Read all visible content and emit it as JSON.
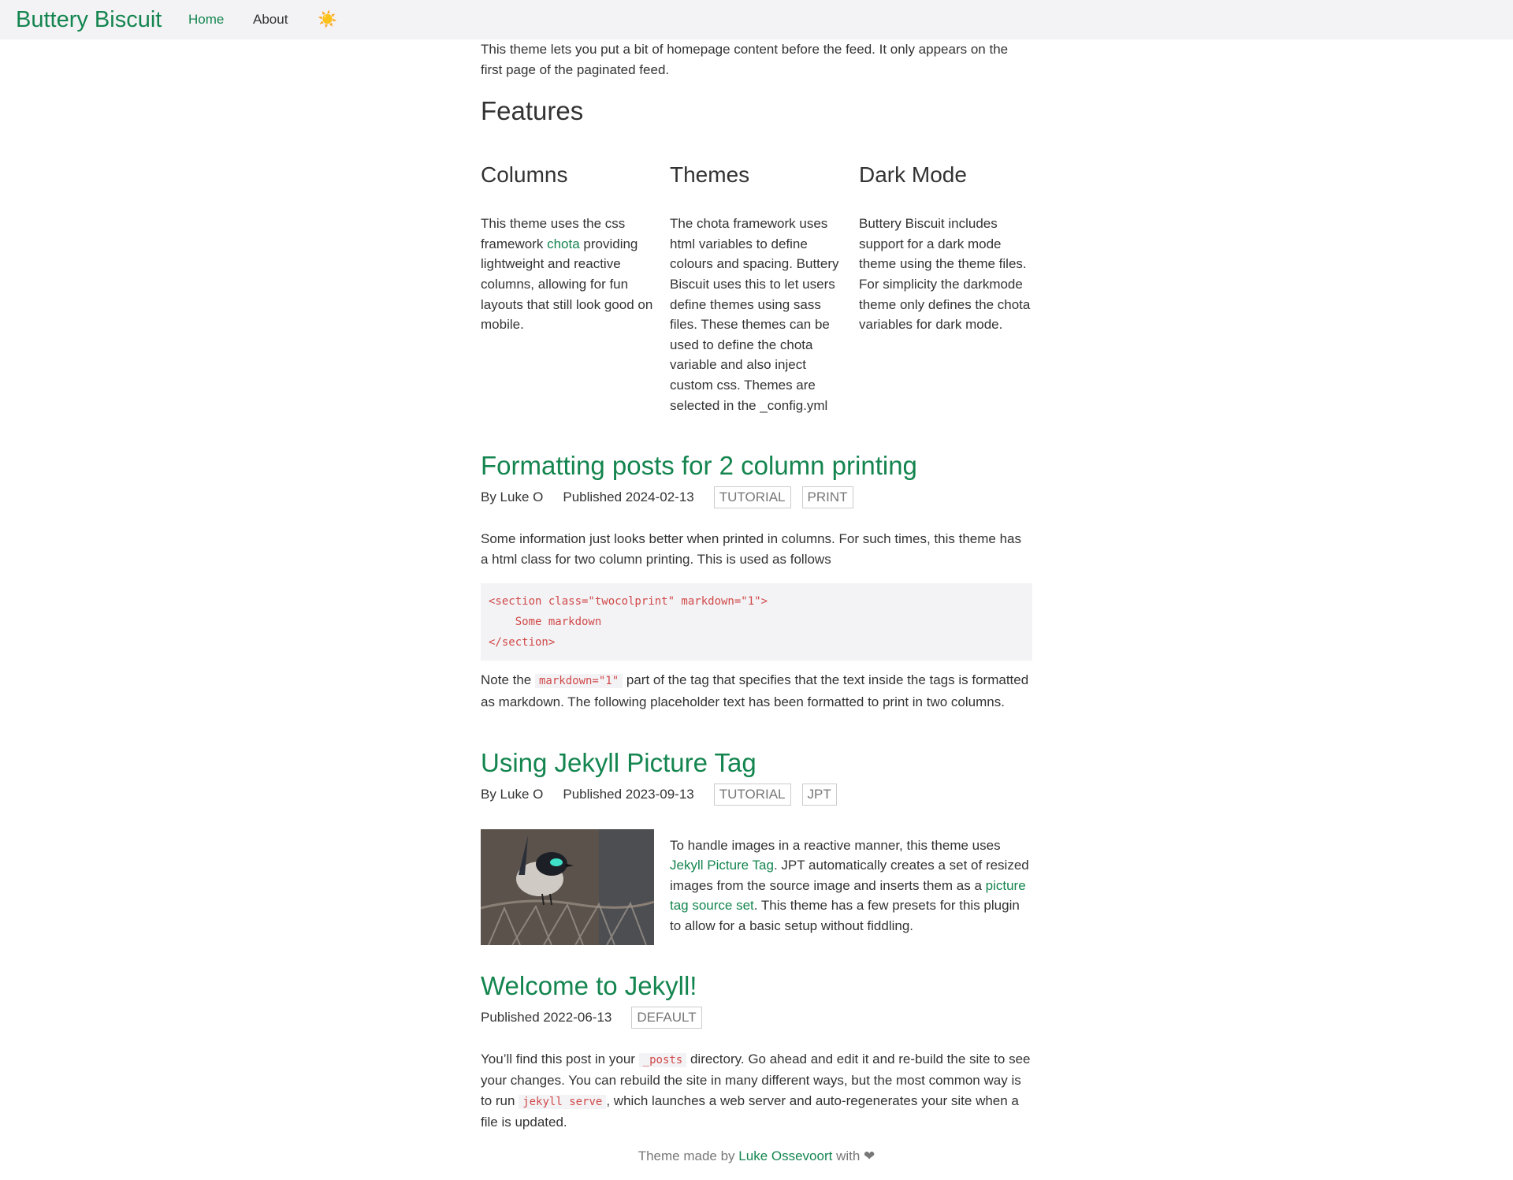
{
  "nav": {
    "brand": "Buttery Biscuit",
    "home": "Home",
    "about": "About",
    "theme_toggle": "☀️"
  },
  "intro": "This theme lets you put a bit of homepage content before the feed. It only appears on the first page of the paginated feed.",
  "features": {
    "heading": "Features",
    "columns": [
      {
        "title": "Columns",
        "text_before": "This theme uses the css framework ",
        "link": "chota",
        "text_after": " providing lightweight and reactive columns, allowing for fun layouts that still look good on mobile."
      },
      {
        "title": "Themes",
        "text": "The chota framework uses html variables to define colours and spacing. Buttery Biscuit uses this to let users define themes using sass files. These themes can be used to define the chota variable and also inject custom css. Themes are selected in the _config.yml"
      },
      {
        "title": "Dark Mode",
        "text": "Buttery Biscuit includes support for a dark mode theme using the theme files. For simplicity the darkmode theme only defines the chota variables for dark mode."
      }
    ]
  },
  "posts": [
    {
      "title": "Formatting posts for 2 column printing",
      "author": "By Luke O",
      "published": "Published 2024-02-13",
      "tags": [
        "TUTORIAL",
        "PRINT"
      ],
      "p1": "Some information just looks better when printed in columns. For such times, this theme has a html class for two column printing. This is used as follows",
      "code": "<section class=\"twocolprint\" markdown=\"1\">\n    Some markdown\n</section>",
      "note_before": "Note the ",
      "note_code": "markdown=\"1\"",
      "note_after": " part of the tag that specifies that the text inside the tags is formatted as markdown. The following placeholder text has been formatted to print in two columns."
    },
    {
      "title": "Using Jekyll Picture Tag",
      "author": "By Luke O",
      "published": "Published 2023-09-13",
      "tags": [
        "TUTORIAL",
        "JPT"
      ],
      "t1": "To handle images in a reactive manner, this theme uses ",
      "link1": "Jekyll Picture Tag",
      "t2": ". JPT automatically creates a set of resized images from the source image and inserts them as a ",
      "link2": "picture tag source set",
      "t3": ". This theme has a few presets for this plugin to allow for a basic setup without fiddling."
    },
    {
      "title": "Welcome to Jekyll!",
      "published": "Published 2022-06-13",
      "tags": [
        "DEFAULT"
      ],
      "t1": "You’ll find this post in your ",
      "code1": "_posts",
      "t2": " directory. Go ahead and edit it and re-build the site to see your changes. You can rebuild the site in many different ways, but the most common way is to run ",
      "code2": "jekyll serve",
      "t3": ", which launches a web server and auto-regenerates your site when a file is updated."
    }
  ],
  "footer": {
    "before": "Theme made by ",
    "link": "Luke Ossevoort",
    "after": " with ",
    "heart": "❤"
  },
  "colors": {
    "accent": "#14854f",
    "nav_bg": "#f3f3f6",
    "code": "#d14848"
  }
}
